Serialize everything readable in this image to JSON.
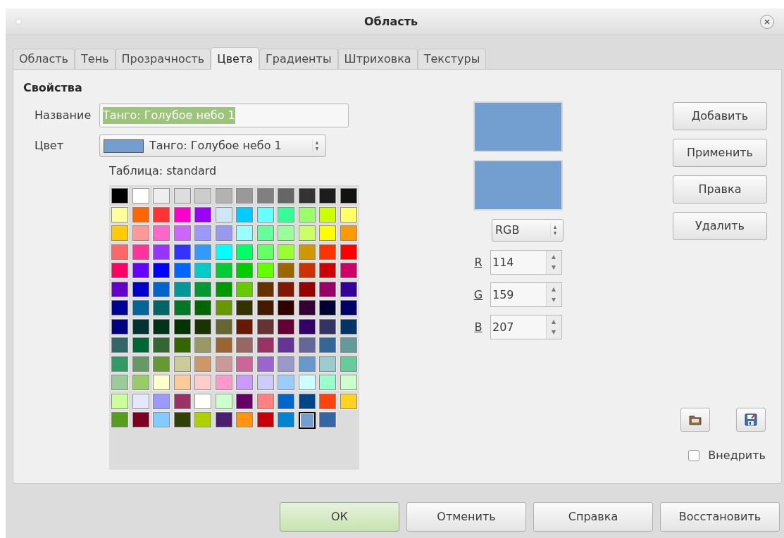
{
  "window": {
    "title": "Область"
  },
  "tabs": [
    {
      "label": "Область",
      "selected": false
    },
    {
      "label": "Тень",
      "selected": false
    },
    {
      "label": "Прозрачность",
      "selected": false
    },
    {
      "label": "Цвета",
      "selected": true
    },
    {
      "label": "Градиенты",
      "selected": false
    },
    {
      "label": "Штриховка",
      "selected": false
    },
    {
      "label": "Текстуры",
      "selected": false
    }
  ],
  "section_title": "Свойства",
  "name_field": {
    "label": "Название",
    "value": "Танго: Голубое небо 1",
    "text_selected": true
  },
  "color_select": {
    "label": "Цвет",
    "value": "Танго: Голубое небо 1",
    "color": "#729fcf"
  },
  "table_label": {
    "text": "Таблица: standard"
  },
  "palette": [
    [
      {
        "color": "#000000",
        "selected": false
      },
      {
        "color": "#ffffff",
        "selected": false
      },
      {
        "color": "#eeeeee",
        "selected": false
      },
      {
        "color": "#dddddd",
        "selected": false
      },
      {
        "color": "#cccccc",
        "selected": false
      },
      {
        "color": "#b2b2b2",
        "selected": false
      },
      {
        "color": "#999999",
        "selected": false
      },
      {
        "color": "#808080",
        "selected": false
      },
      {
        "color": "#666666",
        "selected": false
      },
      {
        "color": "#333333",
        "selected": false
      },
      {
        "color": "#1c1c1c",
        "selected": false
      },
      {
        "color": "#111111",
        "selected": false
      }
    ],
    [
      {
        "color": "#ffff99",
        "selected": false
      },
      {
        "color": "#ff6600",
        "selected": false
      },
      {
        "color": "#ff3333",
        "selected": false
      },
      {
        "color": "#ff00cc",
        "selected": false
      },
      {
        "color": "#9900ff",
        "selected": false
      },
      {
        "color": "#cfe7f5",
        "selected": false
      },
      {
        "color": "#00ccff",
        "selected": false
      },
      {
        "color": "#66ffff",
        "selected": false
      },
      {
        "color": "#33ff99",
        "selected": false
      },
      {
        "color": "#99ff66",
        "selected": false
      },
      {
        "color": "#ccff00",
        "selected": false
      },
      {
        "color": "#ffff66",
        "selected": false
      }
    ],
    [
      {
        "color": "#ffcc00",
        "selected": false
      },
      {
        "color": "#ff9999",
        "selected": false
      },
      {
        "color": "#ff66cc",
        "selected": false
      },
      {
        "color": "#cc66ff",
        "selected": false
      },
      {
        "color": "#9999ff",
        "selected": false
      },
      {
        "color": "#9999ee",
        "selected": false
      },
      {
        "color": "#99ffff",
        "selected": false
      },
      {
        "color": "#66ff99",
        "selected": false
      },
      {
        "color": "#99ff99",
        "selected": false
      },
      {
        "color": "#ccff66",
        "selected": false
      },
      {
        "color": "#ffff00",
        "selected": false
      },
      {
        "color": "#ff9900",
        "selected": false
      }
    ],
    [
      {
        "color": "#ff6666",
        "selected": false
      },
      {
        "color": "#ff3399",
        "selected": false
      },
      {
        "color": "#9933ff",
        "selected": false
      },
      {
        "color": "#3333ff",
        "selected": false
      },
      {
        "color": "#3399ff",
        "selected": false
      },
      {
        "color": "#00ffff",
        "selected": false
      },
      {
        "color": "#00ff66",
        "selected": false
      },
      {
        "color": "#66ff66",
        "selected": false
      },
      {
        "color": "#99ff33",
        "selected": false
      },
      {
        "color": "#cc9900",
        "selected": false
      },
      {
        "color": "#ff3300",
        "selected": false
      },
      {
        "color": "#ff0000",
        "selected": false
      }
    ],
    [
      {
        "color": "#ff0066",
        "selected": false
      },
      {
        "color": "#6600ff",
        "selected": false
      },
      {
        "color": "#0000ff",
        "selected": false
      },
      {
        "color": "#0066ff",
        "selected": false
      },
      {
        "color": "#00cccc",
        "selected": false
      },
      {
        "color": "#00cc33",
        "selected": false
      },
      {
        "color": "#00cc00",
        "selected": false
      },
      {
        "color": "#66ff00",
        "selected": false
      },
      {
        "color": "#996600",
        "selected": false
      },
      {
        "color": "#cc3300",
        "selected": false
      },
      {
        "color": "#cc0000",
        "selected": false
      },
      {
        "color": "#cc0066",
        "selected": false
      }
    ],
    [
      {
        "color": "#6600cc",
        "selected": false
      },
      {
        "color": "#0000cc",
        "selected": false
      },
      {
        "color": "#0066cc",
        "selected": false
      },
      {
        "color": "#009999",
        "selected": false
      },
      {
        "color": "#009933",
        "selected": false
      },
      {
        "color": "#009900",
        "selected": false
      },
      {
        "color": "#66cc00",
        "selected": false
      },
      {
        "color": "#663300",
        "selected": false
      },
      {
        "color": "#801900",
        "selected": false
      },
      {
        "color": "#990000",
        "selected": false
      },
      {
        "color": "#990066",
        "selected": false
      },
      {
        "color": "#330099",
        "selected": false
      }
    ],
    [
      {
        "color": "#000099",
        "selected": false
      },
      {
        "color": "#006699",
        "selected": false
      },
      {
        "color": "#006666",
        "selected": false
      },
      {
        "color": "#007826",
        "selected": false
      },
      {
        "color": "#006600",
        "selected": false
      },
      {
        "color": "#669900",
        "selected": false
      },
      {
        "color": "#333300",
        "selected": false
      },
      {
        "color": "#441a00",
        "selected": false
      },
      {
        "color": "#330000",
        "selected": false
      },
      {
        "color": "#330033",
        "selected": false
      },
      {
        "color": "#000033",
        "selected": false
      },
      {
        "color": "#000066",
        "selected": false
      }
    ],
    [
      {
        "color": "#000080",
        "selected": false
      },
      {
        "color": "#003333",
        "selected": false
      },
      {
        "color": "#003319",
        "selected": false
      },
      {
        "color": "#003300",
        "selected": false
      },
      {
        "color": "#1a3300",
        "selected": false
      },
      {
        "color": "#666633",
        "selected": false
      },
      {
        "color": "#661a00",
        "selected": false
      },
      {
        "color": "#663333",
        "selected": false
      },
      {
        "color": "#660033",
        "selected": false
      },
      {
        "color": "#330066",
        "selected": false
      },
      {
        "color": "#333366",
        "selected": false
      },
      {
        "color": "#003366",
        "selected": false
      }
    ],
    [
      {
        "color": "#336666",
        "selected": false
      },
      {
        "color": "#006633",
        "selected": false
      },
      {
        "color": "#336633",
        "selected": false
      },
      {
        "color": "#336600",
        "selected": false
      },
      {
        "color": "#999966",
        "selected": false
      },
      {
        "color": "#996633",
        "selected": false
      },
      {
        "color": "#996666",
        "selected": false
      },
      {
        "color": "#993366",
        "selected": false
      },
      {
        "color": "#663399",
        "selected": false
      },
      {
        "color": "#666699",
        "selected": false
      },
      {
        "color": "#336699",
        "selected": false
      },
      {
        "color": "#669999",
        "selected": false
      }
    ],
    [
      {
        "color": "#339966",
        "selected": false
      },
      {
        "color": "#669966",
        "selected": false
      },
      {
        "color": "#669933",
        "selected": false
      },
      {
        "color": "#cccc99",
        "selected": false
      },
      {
        "color": "#cc9966",
        "selected": false
      },
      {
        "color": "#cc9999",
        "selected": false
      },
      {
        "color": "#cc6699",
        "selected": false
      },
      {
        "color": "#9966cc",
        "selected": false
      },
      {
        "color": "#9999cc",
        "selected": false
      },
      {
        "color": "#6699cc",
        "selected": false
      },
      {
        "color": "#99cccc",
        "selected": false
      },
      {
        "color": "#66cc99",
        "selected": false
      }
    ],
    [
      {
        "color": "#99cc99",
        "selected": false
      },
      {
        "color": "#99cc66",
        "selected": false
      },
      {
        "color": "#ffffcc",
        "selected": false
      },
      {
        "color": "#ffcc99",
        "selected": false
      },
      {
        "color": "#ffcccc",
        "selected": false
      },
      {
        "color": "#ff99cc",
        "selected": false
      },
      {
        "color": "#cc99ff",
        "selected": false
      },
      {
        "color": "#ccccff",
        "selected": false
      },
      {
        "color": "#99ccff",
        "selected": false
      },
      {
        "color": "#ccffff",
        "selected": false
      },
      {
        "color": "#99ffcc",
        "selected": false
      },
      {
        "color": "#ccffcc",
        "selected": false
      }
    ],
    [
      {
        "color": "#ccff99",
        "selected": false
      },
      {
        "color": "#e6e6ff",
        "selected": false
      },
      {
        "color": "#9999fe",
        "selected": false
      },
      {
        "color": "#993365",
        "selected": false
      },
      {
        "color": "#fffffc",
        "selected": false
      },
      {
        "color": "#ccffcb",
        "selected": false
      },
      {
        "color": "#660066",
        "selected": false
      },
      {
        "color": "#ff8080",
        "selected": false
      },
      {
        "color": "#0066cb",
        "selected": false
      },
      {
        "color": "#004586",
        "selected": false
      },
      {
        "color": "#ff420e",
        "selected": false
      },
      {
        "color": "#ffd320",
        "selected": false
      }
    ],
    [
      {
        "color": "#579d1c",
        "selected": false
      },
      {
        "color": "#7e0021",
        "selected": false
      },
      {
        "color": "#83caff",
        "selected": false
      },
      {
        "color": "#314004",
        "selected": false
      },
      {
        "color": "#aecf00",
        "selected": false
      },
      {
        "color": "#4b1f6f",
        "selected": false
      },
      {
        "color": "#ff950e",
        "selected": false
      },
      {
        "color": "#c5000b",
        "selected": false
      },
      {
        "color": "#0084d1",
        "selected": false
      },
      {
        "color": "#729fcf",
        "selected": true
      },
      {
        "color": "#3465a4",
        "selected": false
      }
    ]
  ],
  "previews": [
    {
      "color": "#729fcf"
    },
    {
      "color": "#729fcf"
    }
  ],
  "color_model": "RGB",
  "channels": [
    {
      "label": "R",
      "value": "114"
    },
    {
      "label": "G",
      "value": "159"
    },
    {
      "label": "B",
      "value": "207"
    }
  ],
  "side_buttons": [
    {
      "label": "Добавить"
    },
    {
      "label": "Применить"
    },
    {
      "label": "Правка"
    },
    {
      "label": "Удалить"
    }
  ],
  "file_buttons": [
    {
      "kind": "open"
    },
    {
      "kind": "save"
    }
  ],
  "embed": {
    "label": "Внедрить",
    "checked": false
  },
  "buttons": [
    {
      "label": "ОК",
      "default": true
    },
    {
      "label": "Отменить",
      "default": false
    },
    {
      "label": "Справка",
      "default": false
    },
    {
      "label": "Восстановить",
      "default": false
    }
  ]
}
